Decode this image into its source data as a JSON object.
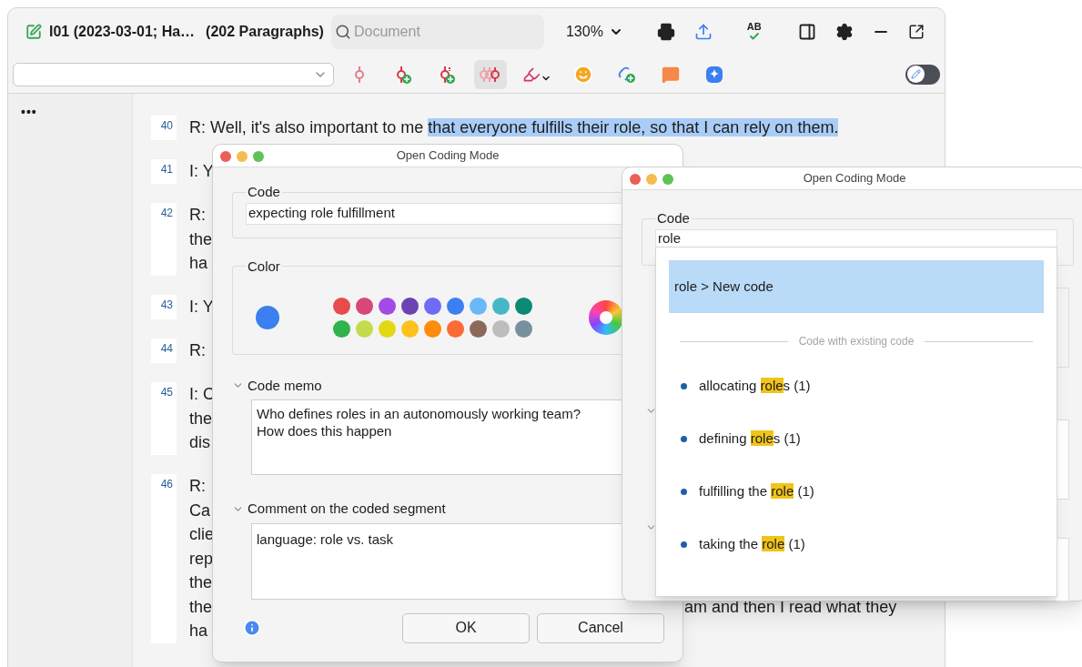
{
  "window": {
    "title": "I01 (2023-03-01; Ha…",
    "paragraph_count": "(202 Paragraphs)"
  },
  "search": {
    "placeholder": "Document"
  },
  "zoom": "130%",
  "spellcheck_label": "AB",
  "edit_mode": {
    "on": false
  },
  "toolbar": [
    {
      "kind": "code-pin",
      "selected": false
    },
    {
      "kind": "code-add",
      "selected": false
    },
    {
      "kind": "code-add-list",
      "selected": false
    },
    {
      "kind": "code-multi",
      "selected": true
    },
    {
      "kind": "highlighter",
      "selected": false
    },
    {
      "kind": "emoji",
      "selected": false
    },
    {
      "kind": "link-add",
      "selected": false
    },
    {
      "kind": "comment",
      "selected": false
    },
    {
      "kind": "sparkle",
      "selected": false
    }
  ],
  "sidebar": {
    "more": "•••"
  },
  "paragraphs": [
    {
      "number": "40",
      "lines": [
        {
          "text": "R: Well, it's also important to me ",
          "highlight": "that everyone fulfills their role, so that I can rely on them."
        }
      ]
    },
    {
      "number": "41",
      "lines": [
        {
          "text": "I: Y"
        }
      ]
    },
    {
      "number": "42",
      "lines": [
        {
          "text": "R:"
        },
        {
          "text": "the"
        },
        {
          "text": "ha"
        }
      ]
    },
    {
      "number": "43",
      "lines": [
        {
          "text": "I: Y"
        }
      ]
    },
    {
      "number": "44",
      "lines": [
        {
          "text": "R:"
        }
      ]
    },
    {
      "number": "45",
      "lines": [
        {
          "text": "I: C"
        },
        {
          "text": "the"
        },
        {
          "text": "dis"
        }
      ]
    },
    {
      "number": "46",
      "lines": [
        {
          "text": "R:"
        },
        {
          "text": "Ca"
        },
        {
          "text": "clie"
        },
        {
          "text": "rep"
        },
        {
          "text": "the"
        },
        {
          "text": "the",
          "tail": "am and then I read what they"
        },
        {
          "text": "ha"
        }
      ]
    }
  ],
  "dialog_1": {
    "title": "Open Coding Mode",
    "code_label": "Code",
    "code_value": "expecting role fulfillment",
    "color_label": "Color",
    "selected_swatch": {
      "color": "#3b7ff0"
    },
    "palette": [
      {
        "color": "#e84b4b"
      },
      {
        "color": "#d6487a"
      },
      {
        "color": "#a34be6"
      },
      {
        "color": "#6a44b3"
      },
      {
        "color": "#6e6cf5"
      },
      {
        "color": "#3b7ff0"
      },
      {
        "color": "#6bb8f7"
      },
      {
        "color": "#45b8c8"
      },
      {
        "color": "#0b8a75"
      },
      {
        "color": "#2fb34d"
      },
      {
        "color": "#c3dc4e"
      },
      {
        "color": "#e2d814"
      },
      {
        "color": "#fcc21b"
      },
      {
        "color": "#fd8c0a"
      },
      {
        "color": "#fd6a35"
      },
      {
        "color": "#8c6a5a"
      },
      {
        "color": "#bdbdbd"
      },
      {
        "color": "#78909c"
      }
    ],
    "memo_label": "Code memo",
    "memo_expanded": true,
    "memo_value": "Who defines roles in an autonomously working team? How does this happen",
    "comment_label": "Comment on the coded segment",
    "comment_expanded": true,
    "comment_value": "language: role vs. task",
    "buttons": [
      "OK",
      "Cancel"
    ]
  },
  "dialog_2": {
    "title": "Open Coding Mode",
    "code_label": "Code",
    "code_value": "role",
    "suggestions": {
      "new_code": {
        "label": "role > New code",
        "selected": true
      },
      "separator": "Code with existing code",
      "items": [
        {
          "before": "allocating ",
          "match": "role",
          "after": "s (1)"
        },
        {
          "before": "defining ",
          "match": "role",
          "after": "s (1)"
        },
        {
          "before": "fulfilling the ",
          "match": "role",
          "after": " (1)"
        },
        {
          "before": "taking the ",
          "match": "role",
          "after": " (1)"
        }
      ]
    }
  }
}
